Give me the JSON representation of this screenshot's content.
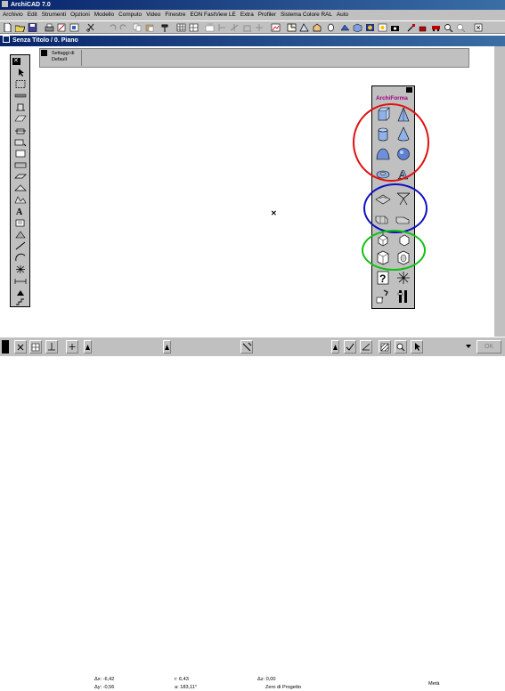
{
  "app": {
    "title": "ArchiCAD 7.0"
  },
  "menu": [
    "Archivio",
    "Edit",
    "Strumenti",
    "Opzioni",
    "Modello",
    "Computo",
    "Video",
    "Finestre",
    "EON FastView LE",
    "Extra",
    "Profiler",
    "Sistema Colore RAL",
    "Auto"
  ],
  "document": {
    "title": "Senza Titolo / 0. Piano"
  },
  "info_box": {
    "settings_label": "Settaggi di Default"
  },
  "palette": {
    "title": "ArchiForma"
  },
  "highlight_colors": {
    "red": "#e01010",
    "blue": "#1010c0",
    "green": "#10c010"
  },
  "status": {
    "dx": "Δx: -6,42",
    "dy": "Δy: -0,56",
    "r": "r: 6,43",
    "a": "a: 183,11°",
    "dz": "Δz: 0,00",
    "ref": "Zero di Progetto",
    "scale": "Metà",
    "ok": "OK"
  }
}
